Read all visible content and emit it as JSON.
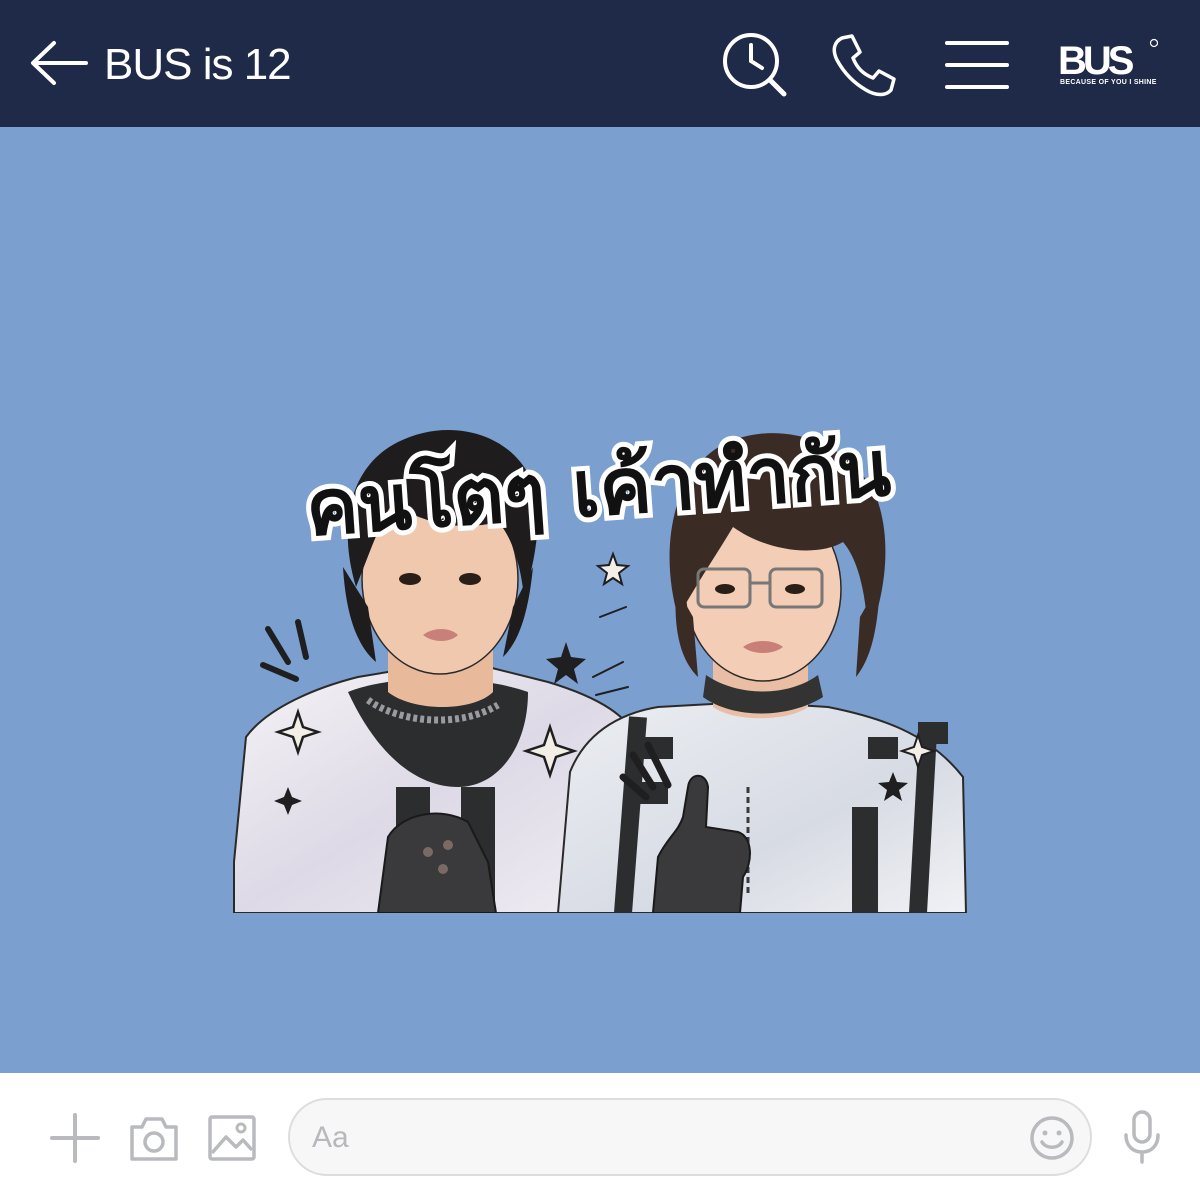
{
  "header": {
    "title": "BUS is 12",
    "logo_text": "BUS",
    "logo_tagline": "BECAUSE OF YOU I SHINE"
  },
  "icons": {
    "back": "arrow-left-icon",
    "search": "search-clock-icon",
    "call": "phone-icon",
    "menu": "hamburger-menu-icon",
    "add": "plus-icon",
    "camera": "camera-icon",
    "gallery": "image-icon",
    "emoji": "smiley-icon",
    "voice": "microphone-icon"
  },
  "sticker": {
    "caption": "คนโตๆ เค้าทำกัน"
  },
  "composer": {
    "placeholder": "Aa"
  },
  "colors": {
    "header_bg": "#1f2a48",
    "chat_bg": "#7b9fcf",
    "composer_bg": "#ffffff",
    "icon_gray": "#b9babe"
  }
}
